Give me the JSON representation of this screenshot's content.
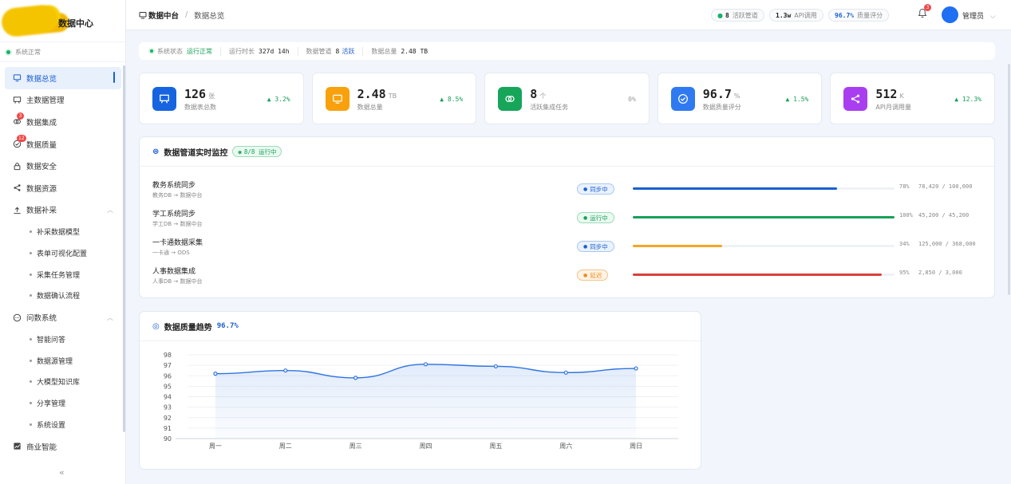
{
  "sidebar": {
    "logo_text": "数据中心",
    "system_status": "系统正常",
    "items": [
      {
        "label": "数据总览",
        "icon": "monitor-icon",
        "active": true
      },
      {
        "label": "主数据管理",
        "icon": "board-icon"
      },
      {
        "label": "数据集成",
        "icon": "link-icon",
        "badge": "3"
      },
      {
        "label": "数据质量",
        "icon": "check-circle-icon",
        "badge": "12"
      },
      {
        "label": "数据安全",
        "icon": "lock-icon"
      },
      {
        "label": "数据资源",
        "icon": "share-icon"
      },
      {
        "label": "数据补采",
        "icon": "upload-icon",
        "expanded": true,
        "children": [
          "补采数据模型",
          "表单可视化配置",
          "采集任务管理",
          "数据确认流程"
        ]
      },
      {
        "label": "问数系统",
        "icon": "chat-icon",
        "expanded": true,
        "children": [
          "智能问答",
          "数据源管理",
          "大模型知识库",
          "分享管理",
          "系统设置"
        ]
      },
      {
        "label": "商业智能",
        "icon": "chart-icon"
      }
    ]
  },
  "header": {
    "breadcrumb_root": "数据中台",
    "breadcrumb_current": "数据总览",
    "pills": [
      {
        "value": "8",
        "label": "活跃管道"
      },
      {
        "value": "1.3w",
        "label": "API调用"
      },
      {
        "value": "96.7%",
        "label": "质量评分"
      }
    ],
    "notification_count": "3",
    "user": "管理员"
  },
  "statusbar": {
    "status_label": "系统状态",
    "status_value": "运行正常",
    "uptime_label": "运行时长",
    "uptime_value": "327d 14h",
    "pipes_label": "数据管道",
    "pipes_value": "8",
    "pipes_active": "活跃",
    "total_label": "数据总量",
    "total_value": "2.48 TB"
  },
  "cards": [
    {
      "value": "126",
      "unit": "张",
      "label": "数据表总数",
      "change": "▲ 3.2%",
      "color": "#1664e0",
      "icon": "board-icon"
    },
    {
      "value": "2.48",
      "unit": "TB",
      "label": "数据总量",
      "change": "▲ 8.5%",
      "color": "#f8a10c",
      "icon": "monitor-icon"
    },
    {
      "value": "8",
      "unit": "个",
      "label": "活跃集成任务",
      "change": "0%",
      "color": "#17a55a",
      "icon": "link-icon"
    },
    {
      "value": "96.7",
      "unit": "%",
      "label": "数据质量评分",
      "change": "▲ 1.5%",
      "color": "#2f7af0",
      "icon": "check-circle-icon"
    },
    {
      "value": "512",
      "unit": "K",
      "label": "API月调用量",
      "change": "▲ 12.3%",
      "color": "#a93ef0",
      "icon": "share-icon"
    }
  ],
  "pipeline_panel": {
    "title": "数据管道实时监控",
    "tag": "8/8 运行中",
    "pipelines": [
      {
        "name": "教务系统同步",
        "route": "教务DB → 数据中台",
        "status": "同步中",
        "kind": "sync",
        "progress": 0.78,
        "pct": "78%",
        "count": "78,420 / 100,000",
        "color": "#1a5fd1"
      },
      {
        "name": "学工系统同步",
        "route": "学工DB → 数据中台",
        "status": "运行中",
        "kind": "run",
        "progress": 1.0,
        "pct": "100%",
        "count": "45,200 / 45,200",
        "color": "#18a058"
      },
      {
        "name": "一卡通数据采集",
        "route": "一卡通 → ODS",
        "status": "同步中",
        "kind": "sync",
        "progress": 0.34,
        "pct": "34%",
        "count": "125,000 / 368,000",
        "color": "#f5a623"
      },
      {
        "name": "人事数据集成",
        "route": "人事DB → 数据中台",
        "status": "延迟",
        "kind": "delay",
        "progress": 0.95,
        "pct": "95%",
        "count": "2,850 / 3,000",
        "color": "#d9413a"
      }
    ]
  },
  "quality_panel": {
    "title": "数据质量趋势",
    "score": "96.7%"
  },
  "chart_data": {
    "type": "line",
    "categories": [
      "周一",
      "周二",
      "周三",
      "周四",
      "周五",
      "周六",
      "周日"
    ],
    "series": [
      {
        "values": [
          96.2,
          96.5,
          95.8,
          97.1,
          96.9,
          96.3,
          96.7
        ]
      }
    ],
    "ylim": [
      90,
      98
    ],
    "yticks": [
      90,
      91,
      92,
      93,
      94,
      95,
      96,
      97,
      98
    ],
    "color": "#2f74e0",
    "grid": true
  }
}
